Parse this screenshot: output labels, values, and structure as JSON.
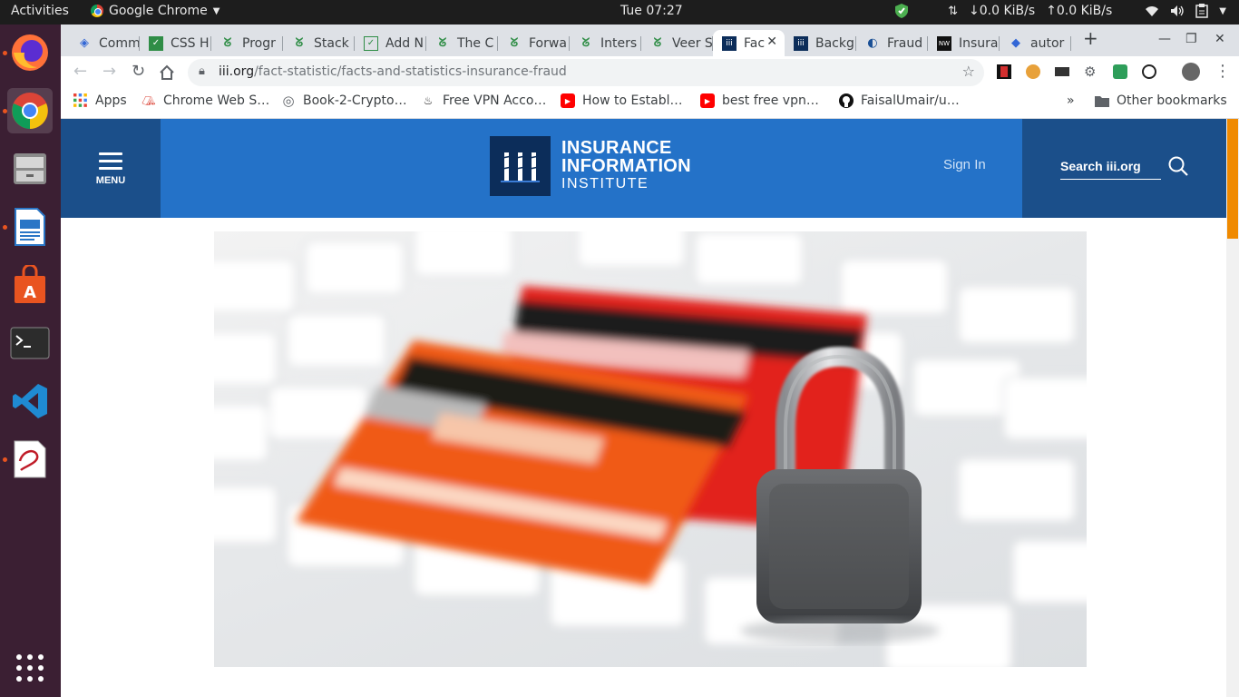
{
  "os": {
    "activities": "Activities",
    "app_name": "Google Chrome",
    "clock": "Tue 07:27",
    "net_down": "↓0.0 KiB/s",
    "net_up": "↑0.0 KiB/s"
  },
  "tabs": [
    {
      "label": "Comm",
      "icon": "app-icon"
    },
    {
      "label": "CSS H",
      "icon": "geeks-icon"
    },
    {
      "label": "Progr",
      "icon": "geeks-icon"
    },
    {
      "label": "Stack",
      "icon": "geeks-icon"
    },
    {
      "label": "Add N",
      "icon": "doc-icon"
    },
    {
      "label": "The C",
      "icon": "geeks-icon"
    },
    {
      "label": "Forwa",
      "icon": "geeks-icon"
    },
    {
      "label": "Inters",
      "icon": "geeks-icon"
    },
    {
      "label": "Veer S",
      "icon": "geeks-icon"
    },
    {
      "label": "Fac",
      "icon": "iii-icon",
      "active": true
    },
    {
      "label": "Backg",
      "icon": "iii-icon"
    },
    {
      "label": "Fraud",
      "icon": "shield-icon"
    },
    {
      "label": "Insura",
      "icon": "site-icon"
    },
    {
      "label": "autor",
      "icon": "cap-icon"
    }
  ],
  "toolbar": {
    "url_domain": "iii.org",
    "url_path": "/fact-statistic/facts-and-statistics-insurance-fraud"
  },
  "bookmarks": [
    {
      "label": "Apps",
      "icon": "apps-grid-icon"
    },
    {
      "label": "Chrome Web S…",
      "icon": "chrome-webstore-icon"
    },
    {
      "label": "Book-2-Crypto…",
      "icon": "globe-icon"
    },
    {
      "label": "Free VPN Acco…",
      "icon": "flame-icon"
    },
    {
      "label": "How to Establ…",
      "icon": "youtube-icon"
    },
    {
      "label": "best free vpn…",
      "icon": "youtube-icon"
    },
    {
      "label": "FaisalUmair/u…",
      "icon": "github-icon"
    }
  ],
  "bookmarks_overflow": "»",
  "other_bookmarks": "Other bookmarks",
  "site": {
    "menu_label": "MENU",
    "logo_line1": "INSURANCE",
    "logo_line2": "INFORMATION",
    "logo_line3": "INSTITUTE",
    "sign_in": "Sign In",
    "search_placeholder": "Search iii.org"
  },
  "colors": {
    "header_blue": "#2472c8",
    "header_dark": "#1b4f8a",
    "logo_navy": "#0c2d5a",
    "dock": "#3b1f33",
    "scroll_accent": "#f08a00"
  }
}
